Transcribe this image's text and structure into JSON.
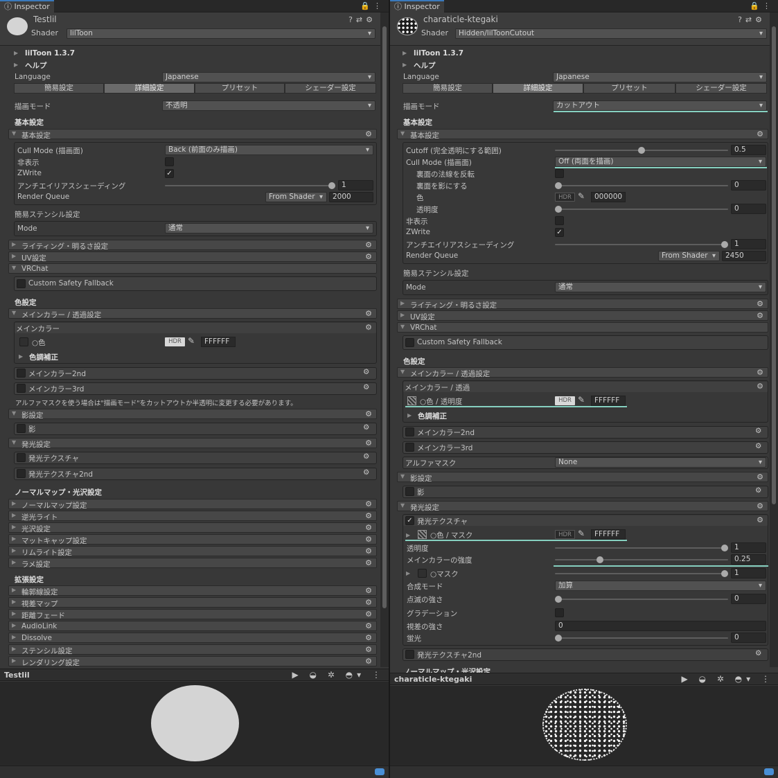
{
  "left": {
    "tab_title": "Inspector",
    "material_name": "Testlil",
    "shader_label": "Shader",
    "shader_value": "lilToon",
    "version": "lilToon 1.3.7",
    "help": "ヘルプ",
    "language_label": "Language",
    "language_value": "Japanese",
    "tabs": [
      "簡易設定",
      "詳細設定",
      "プリセット",
      "シェーダー設定"
    ],
    "render_mode_label": "描画モード",
    "render_mode_value": "不透明",
    "sec_basic": "基本設定",
    "fold_basic": "基本設定",
    "cull_label": "Cull Mode (描画面)",
    "cull_value": "Back (前面のみ描画)",
    "invisible": "非表示",
    "zwrite": "ZWrite",
    "aa_label": "アンチエイリアスシェーディング",
    "aa_value": "1",
    "rq_label": "Render Queue",
    "rq_from": "From Shader",
    "rq_value": "2000",
    "stencil_label": "簡易ステンシル設定",
    "mode_label": "Mode",
    "mode_value": "通常",
    "fold_lighting": "ライティング・明るさ設定",
    "fold_uv": "UV設定",
    "fold_vrchat": "VRChat",
    "custom_safety": "Custom Safety Fallback",
    "sec_color": "色設定",
    "fold_main": "メインカラー / 透過設定",
    "maincolor_box": "メインカラー",
    "color_label": "○色",
    "hdr": "HDR",
    "color_value": "FFFFFF",
    "tone": "色調補正",
    "main2": "メインカラー2nd",
    "main3": "メインカラー3rd",
    "alpha_note": "アルファマスクを使う場合は\"描画モード\"をカットアウトか半透明に変更する必要があります。",
    "fold_shadow": "影設定",
    "shadow": "影",
    "fold_emission": "発光設定",
    "emission": "発光テクスチャ",
    "emission2": "発光テクスチャ2nd",
    "sec_normal": "ノーマルマップ・光沢設定",
    "normal_folds": [
      "ノーマルマップ設定",
      "逆光ライト",
      "光沢設定",
      "マットキャップ設定",
      "リムライト設定",
      "ラメ設定"
    ],
    "sec_ext": "拡張設定",
    "ext_folds": [
      "輪郭線設定",
      "視差マップ",
      "距離フェード",
      "AudioLink",
      "Dissolve",
      "ステンシル設定",
      "レンダリング設定"
    ],
    "preview_name": "Testlil"
  },
  "right": {
    "tab_title": "Inspector",
    "material_name": "charaticle-ktegaki",
    "shader_label": "Shader",
    "shader_value": "Hidden/lilToonCutout",
    "version": "lilToon 1.3.7",
    "help": "ヘルプ",
    "language_label": "Language",
    "language_value": "Japanese",
    "tabs": [
      "簡易設定",
      "詳細設定",
      "プリセット",
      "シェーダー設定"
    ],
    "render_mode_label": "描画モード",
    "render_mode_value": "カットアウト",
    "sec_basic": "基本設定",
    "fold_basic": "基本設定",
    "cutoff_label": "Cutoff (完全透明にする範囲)",
    "cutoff_value": "0.5",
    "cull_label": "Cull Mode (描画面)",
    "cull_value": "Off (両面を描画)",
    "flip_normal": "裏面の法線を反転",
    "back_shadow": "裏面を影にする",
    "back_shadow_value": "0",
    "color_label": "色",
    "hdr": "HDR",
    "back_color": "000000",
    "alpha_label": "透明度",
    "alpha_value": "0",
    "invisible": "非表示",
    "zwrite": "ZWrite",
    "aa_label": "アンチエイリアスシェーディング",
    "aa_value": "1",
    "rq_label": "Render Queue",
    "rq_from": "From Shader",
    "rq_value": "2450",
    "stencil_label": "簡易ステンシル設定",
    "mode_label": "Mode",
    "mode_value": "通常",
    "fold_lighting": "ライティング・明るさ設定",
    "fold_uv": "UV設定",
    "fold_vrchat": "VRChat",
    "custom_safety": "Custom Safety Fallback",
    "sec_color": "色設定",
    "fold_main": "メインカラー / 透過設定",
    "maincolor_box": "メインカラー / 透過",
    "main_color_label": "○色 / 透明度",
    "main_color_value": "FFFFFF",
    "tone": "色調補正",
    "main2": "メインカラー2nd",
    "main3": "メインカラー3rd",
    "alphamask_label": "アルファマスク",
    "alphamask_value": "None",
    "fold_shadow": "影設定",
    "shadow": "影",
    "fold_emission": "発光設定",
    "emission": "発光テクスチャ",
    "emission_color_label": "○色 / マスク",
    "emission_color_value": "FFFFFF",
    "em_alpha_label": "透明度",
    "em_alpha_value": "1",
    "em_main_label": "メインカラーの強度",
    "em_main_value": "0.25",
    "em_mask_label": "○マスク",
    "em_mask_value": "1",
    "blend_label": "合成モード",
    "blend_value": "加算",
    "blink_label": "点滅の強さ",
    "blink_value": "0",
    "gradation_label": "グラデーション",
    "parallax_label": "視差の強さ",
    "parallax_value": "0",
    "fluor_label": "蛍光",
    "fluor_value": "0",
    "emission2": "発光テクスチャ2nd",
    "cut_heading": "ノーマルマップ・光沢設定",
    "preview_name": "charaticle-ktegaki"
  },
  "colors": {
    "accent": "#3a79bb",
    "highlight": "#86d0c0",
    "panel": "#383838"
  }
}
